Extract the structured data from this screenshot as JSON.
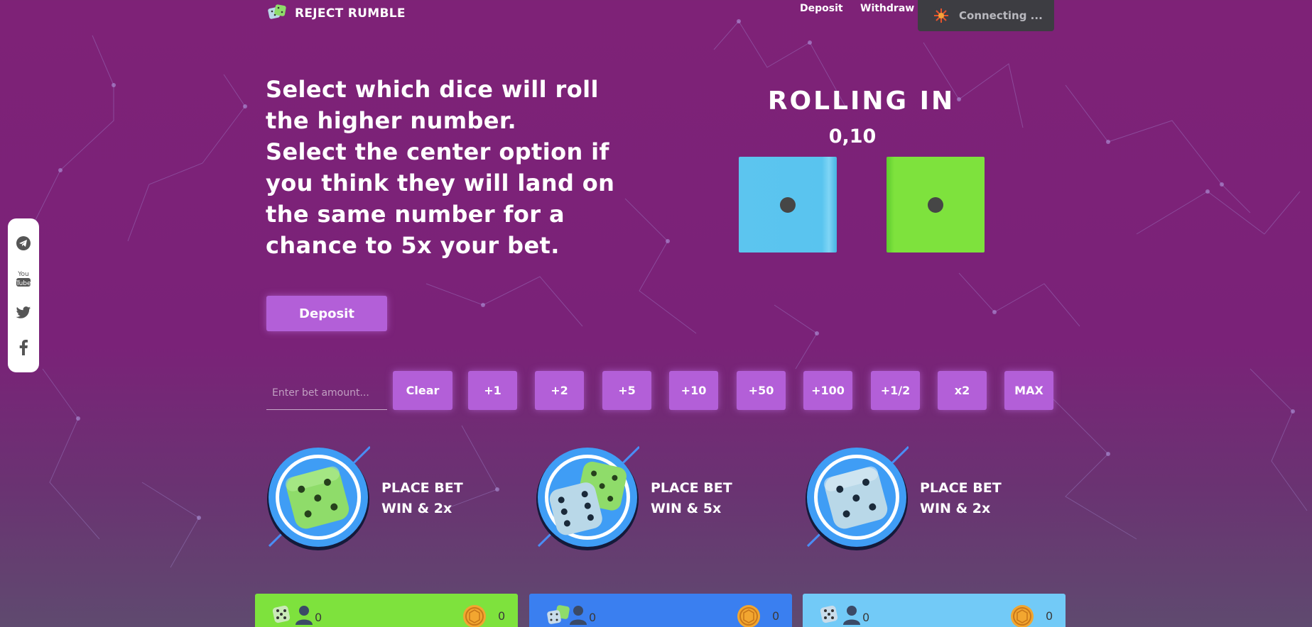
{
  "header": {
    "brand": "REJECT RUMBLE",
    "nav": {
      "deposit": "Deposit",
      "withdraw": "Withdraw"
    },
    "status": "Connecting ..."
  },
  "social": [
    "telegram-icon",
    "youtube-icon",
    "twitter-icon",
    "facebook-icon"
  ],
  "intro": {
    "line1": "Select which dice will roll the higher number.",
    "line2": "Select the center option if you think they will land on the same number for a chance to 5x your bet."
  },
  "deposit_button": "Deposit",
  "rolling": {
    "title": "ROLLING IN",
    "countdown": "0,10"
  },
  "bet": {
    "placeholder": "Enter bet amount...",
    "buttons": [
      "Clear",
      "+1",
      "+2",
      "+5",
      "+10",
      "+50",
      "+100",
      "+1/2",
      "x2",
      "MAX"
    ]
  },
  "options": [
    {
      "line1": "PLACE BET",
      "line2": "WIN & 2x"
    },
    {
      "line1": "PLACE BET",
      "line2": "WIN & 5x"
    },
    {
      "line1": "PLACE BET",
      "line2": "WIN & 2x"
    }
  ],
  "panels": [
    {
      "players": "0",
      "total": "0",
      "color": "#7ee23d"
    },
    {
      "players": "0",
      "total": "0",
      "color": "#3a7ff0"
    },
    {
      "players": "0",
      "total": "0",
      "color": "#72caf7"
    }
  ],
  "colors": {
    "background": "#7e2277",
    "button": "#b35fd8",
    "die_blue": "#5cc5ef",
    "die_green": "#7ee23d"
  }
}
